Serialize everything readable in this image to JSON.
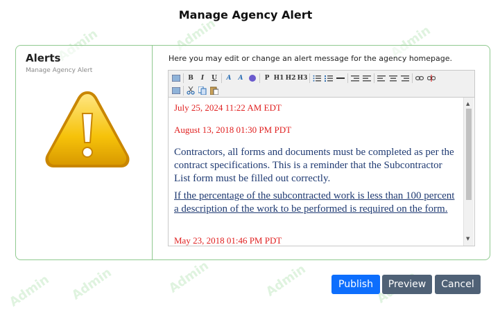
{
  "header": {
    "title": "Manage Agency Alert"
  },
  "watermark": {
    "text": "Admin"
  },
  "sidebar": {
    "title": "Alerts",
    "subtitle": "Manage Agency Alert",
    "icon": "warning-icon"
  },
  "main": {
    "instructions": "Here you may edit or change an alert message for the agency homepage.",
    "editor": {
      "toolbar": {
        "row1": [
          "source",
          "B",
          "I",
          "U",
          "text-color",
          "bg-color",
          "special",
          "P",
          "H1",
          "H2",
          "H3",
          "ordered-list",
          "unordered-list",
          "hr",
          "outdent",
          "indent",
          "align-left",
          "align-center",
          "align-right",
          "link",
          "unlink"
        ],
        "row2": [
          "image",
          "cut",
          "copy",
          "paste"
        ]
      },
      "content": {
        "date1": "July 25, 2024 11:22 AM EDT",
        "date2": "August 13, 2018 01:30 PM PDT",
        "message1": "Contractors, all forms and documents must be completed as per the contract specifications. This is a reminder that the Subcontractor List form must be filled out correctly.",
        "message2": "If the percentage of the subcontracted work is less than 100 percent a description of the work to be performed is required on the form.",
        "date3": "May 23, 2018 01:46 PM PDT"
      }
    }
  },
  "actions": {
    "publish_label": "Publish",
    "preview_label": "Preview",
    "cancel_label": "Cancel"
  },
  "colors": {
    "primary": "#0d6efd",
    "secondary": "#4f6176",
    "panel_border": "#8fc98f",
    "alert_date": "#e02020",
    "alert_text": "#1f3a72"
  }
}
